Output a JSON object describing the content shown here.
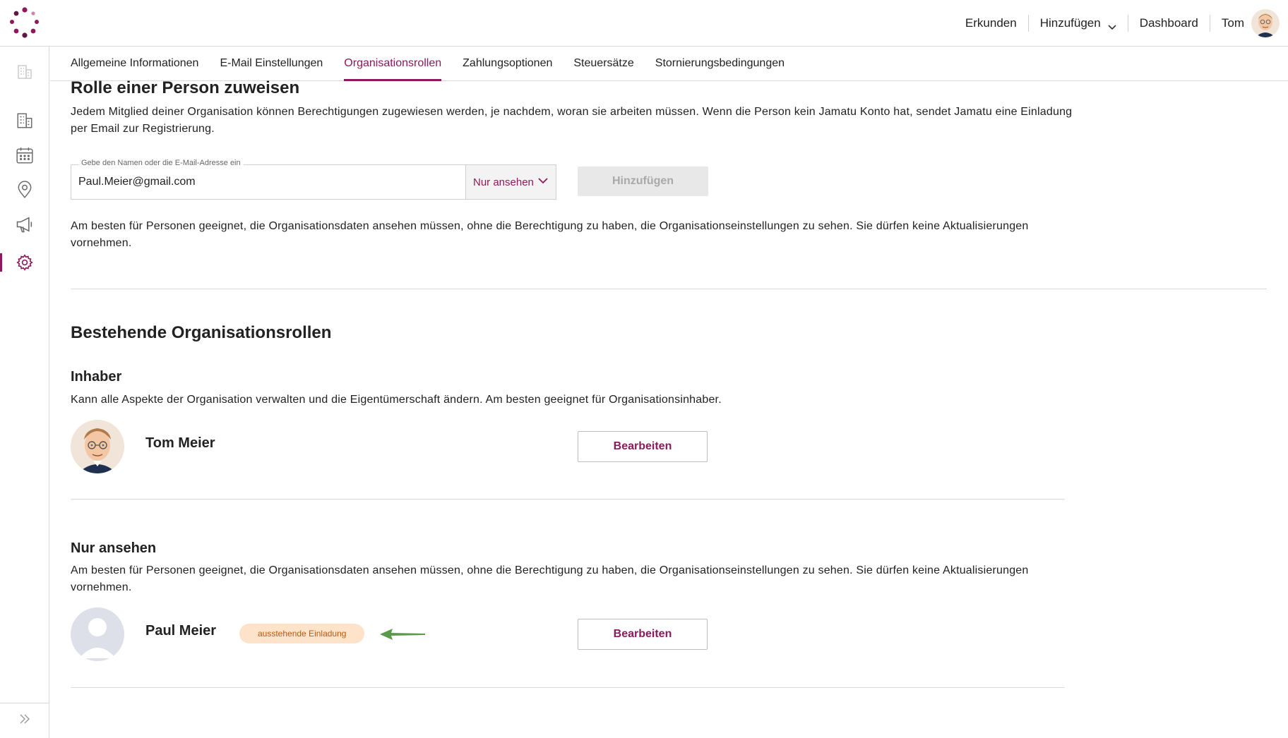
{
  "header": {
    "nav": [
      "Erkunden",
      "Hinzufügen",
      "Dashboard",
      "Tom"
    ]
  },
  "tabs": [
    {
      "label": "Allgemeine Informationen",
      "active": false
    },
    {
      "label": "E-Mail Einstellungen",
      "active": false
    },
    {
      "label": "Organisationsrollen",
      "active": true
    },
    {
      "label": "Zahlungsoptionen",
      "active": false
    },
    {
      "label": "Steuersätze",
      "active": false
    },
    {
      "label": "Stornierungsbedingungen",
      "active": false
    }
  ],
  "sidebar": {
    "icons": [
      "building-icon-faded",
      "building-icon",
      "calendar-icon",
      "location-pin-icon",
      "megaphone-icon",
      "gear-icon"
    ],
    "active": "gear-icon",
    "expand_icon": "double-chevron-right-icon"
  },
  "assign": {
    "title": "Rolle einer Person zuweisen",
    "description": "Jedem Mitglied deiner Organisation können Berechtigungen zugewiesen werden, je nachdem, woran sie arbeiten müssen. Wenn die Person kein Jamatu Konto hat, sendet Jamatu eine Einladung per Email zur Registrierung.",
    "input_label": "Gebe den Namen oder die E-Mail-Adresse ein",
    "input_value": "Paul.Meier@gmail.com",
    "role_select": "Nur ansehen",
    "add_button": "Hinzufügen",
    "role_description": "Am besten für Personen geeignet, die Organisationsdaten ansehen müssen, ohne die Berechtigung zu haben, die Organisationseinstellungen zu sehen. Sie dürfen keine Aktualisierungen vornehmen."
  },
  "existing": {
    "title": "Bestehende Organisationsrollen",
    "owner": {
      "title": "Inhaber",
      "description": "Kann alle Aspekte der Organisation verwalten und die Eigentümerschaft ändern. Am besten geeignet für Organisationsinhaber.",
      "person": "Tom Meier",
      "edit_button": "Bearbeiten"
    },
    "viewer": {
      "title": "Nur ansehen",
      "description": "Am besten für Personen geeignet, die Organisationsdaten ansehen müssen, ohne die Berechtigung zu haben, die Organisationseinstellungen zu sehen. Sie dürfen keine Aktualisierungen vornehmen.",
      "person": "Paul Meier",
      "badge": "ausstehende Einladung",
      "edit_button": "Bearbeiten"
    }
  },
  "colors": {
    "accent": "#8b1a5c",
    "badge_bg": "#fde3c9",
    "badge_text": "#b55a18",
    "arrow": "#5a9a4a"
  }
}
